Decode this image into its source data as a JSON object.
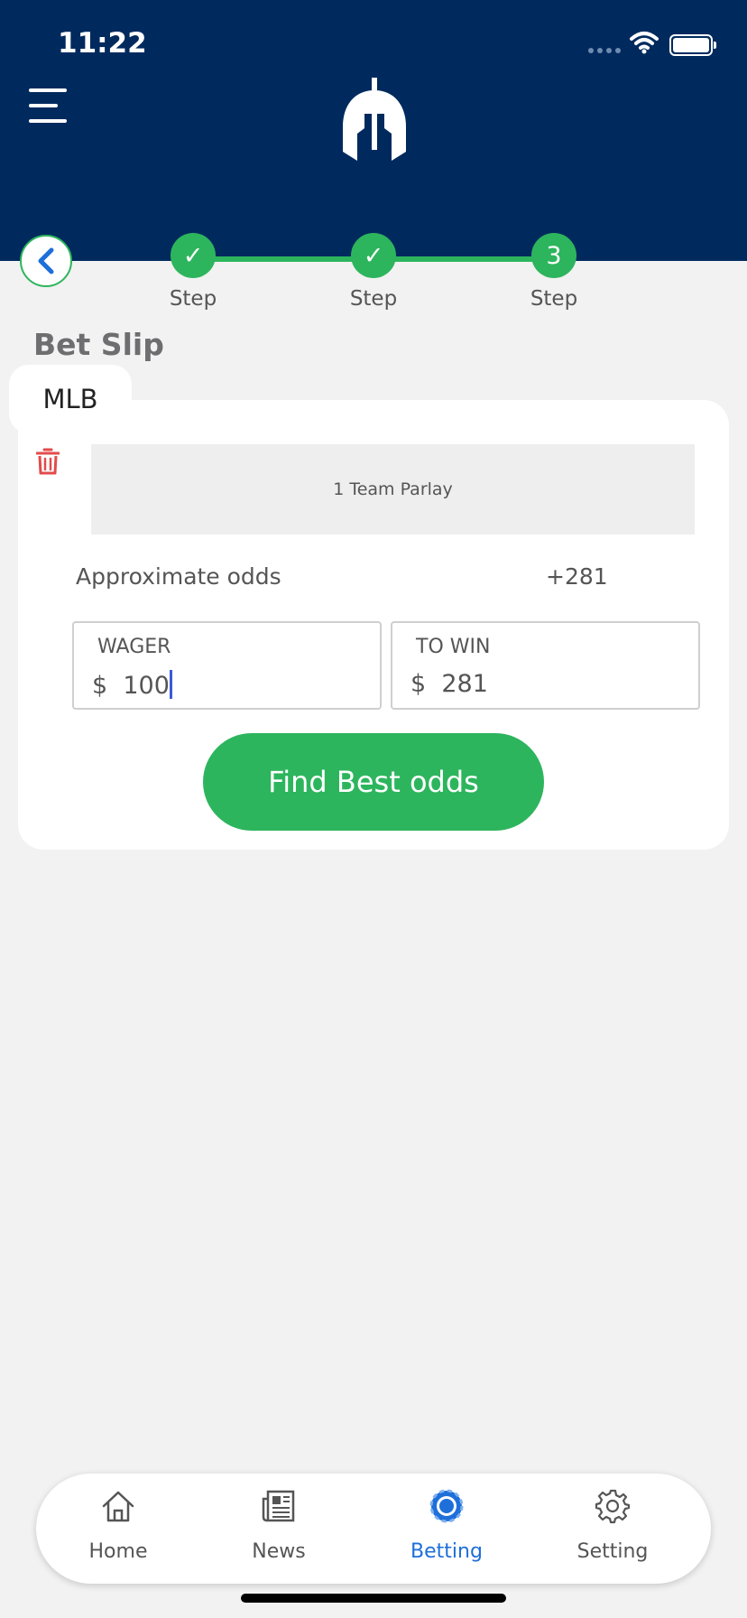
{
  "status_bar": {
    "time": "11:22"
  },
  "stepper": {
    "steps": [
      {
        "marker": "✓",
        "label": "Step"
      },
      {
        "marker": "✓",
        "label": "Step"
      },
      {
        "marker": "3",
        "label": "Step"
      }
    ]
  },
  "bet_slip": {
    "title": "Bet Slip",
    "league": "MLB",
    "parlay_text": "1 Team Parlay",
    "odds_label": "Approximate odds",
    "odds_value": "+281",
    "wager": {
      "label": "WAGER",
      "currency": "$",
      "value": "100"
    },
    "to_win": {
      "label": "TO WIN",
      "currency": "$",
      "value": "281"
    },
    "button_label": "Find Best odds"
  },
  "tabbar": {
    "items": [
      {
        "label": "Home",
        "icon": "home-icon"
      },
      {
        "label": "News",
        "icon": "newspaper-icon"
      },
      {
        "label": "Betting",
        "icon": "poker-chip-icon"
      },
      {
        "label": "Setting",
        "icon": "gear-icon"
      }
    ],
    "active": "Betting"
  },
  "colors": {
    "header": "#002a5e",
    "accent_green": "#2db55d",
    "active_tab": "#1e6fd9",
    "delete_red": "#e24b4b"
  }
}
